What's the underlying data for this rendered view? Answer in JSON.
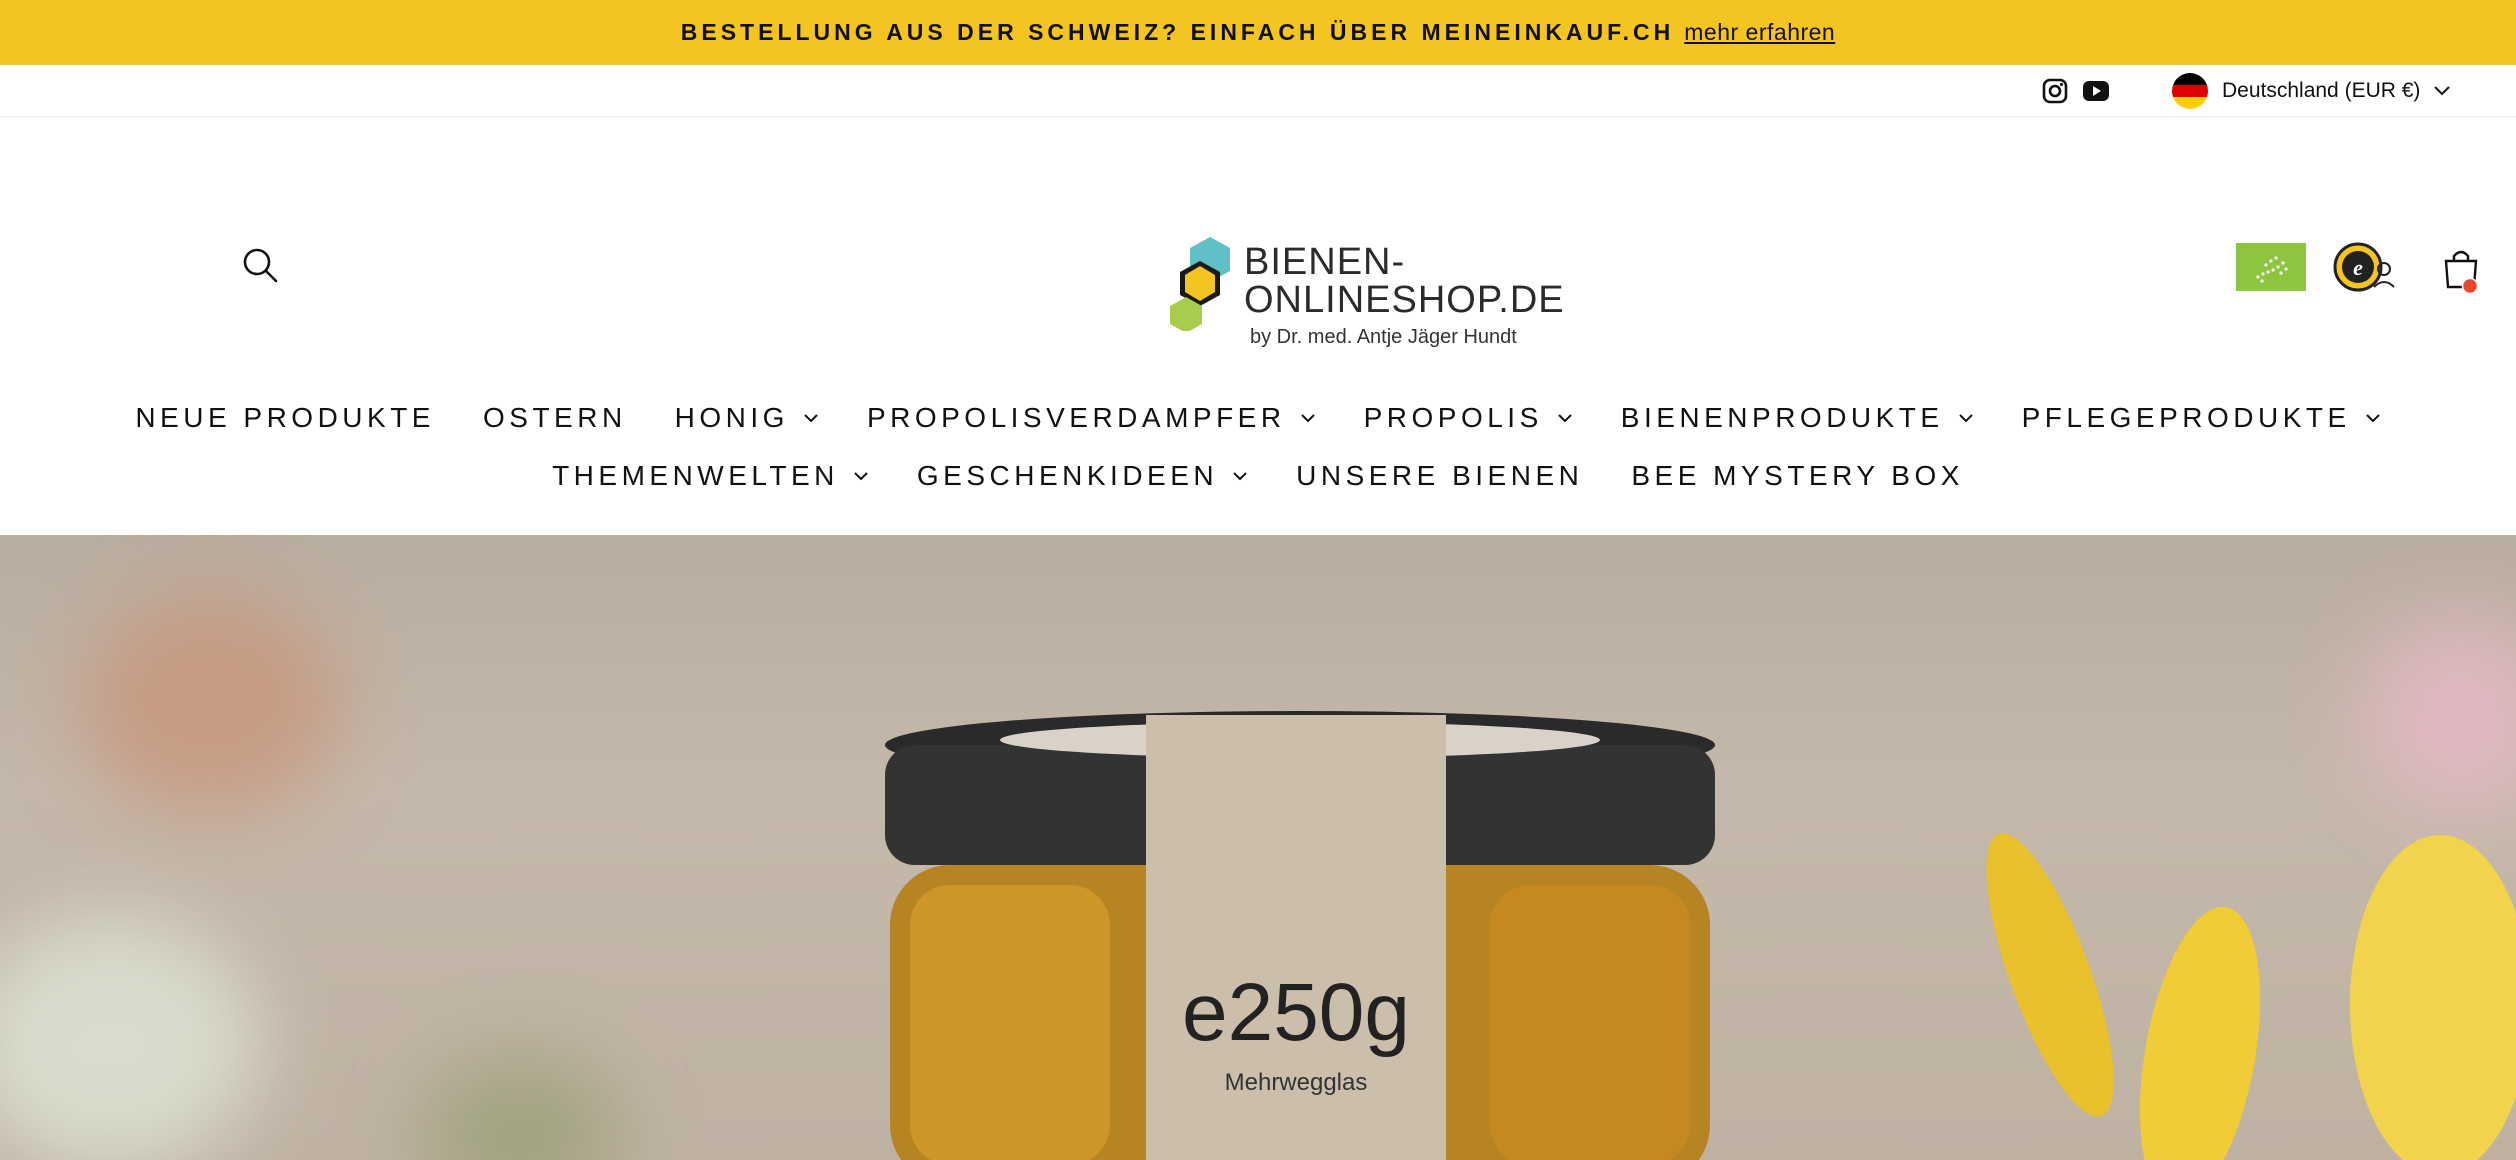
{
  "announcement": {
    "message": "BESTELLUNG AUS DER SCHWEIZ? EINFACH ÜBER MEINEINKAUF.CH",
    "link": "mehr erfahren"
  },
  "utility": {
    "social": [
      "instagram-icon",
      "youtube-icon"
    ],
    "region": "Deutschland (EUR €)",
    "flag_colors": [
      "#000000",
      "#dd0000",
      "#ffce00"
    ]
  },
  "logo": {
    "line1": "BIENEN-",
    "line2": "ONLINESHOP.DE",
    "sub": "by Dr. med. Antje Jäger Hundt"
  },
  "nav": {
    "row1": [
      {
        "label": "NEUE PRODUKTE",
        "dropdown": false
      },
      {
        "label": "OSTERN",
        "dropdown": false
      },
      {
        "label": "HONIG",
        "dropdown": true
      },
      {
        "label": "PROPOLISVERDAMPFER",
        "dropdown": true
      },
      {
        "label": "PROPOLIS",
        "dropdown": true
      },
      {
        "label": "BIENENPRODUKTE",
        "dropdown": true
      },
      {
        "label": "PFLEGEPRODUKTE",
        "dropdown": true
      }
    ],
    "row2": [
      {
        "label": "THEMENWELTEN",
        "dropdown": true
      },
      {
        "label": "GESCHENKIDEEN",
        "dropdown": true
      },
      {
        "label": "UNSERE BIENEN",
        "dropdown": false
      },
      {
        "label": "BEE MYSTERY BOX",
        "dropdown": false
      }
    ]
  },
  "hero": {
    "label_text": "e250g",
    "label_sub": "Mehrwegglas"
  },
  "colors": {
    "announcement_bg": "#f4c522",
    "cart_badge": "#e8472d",
    "eu_green": "#8cc63f"
  }
}
